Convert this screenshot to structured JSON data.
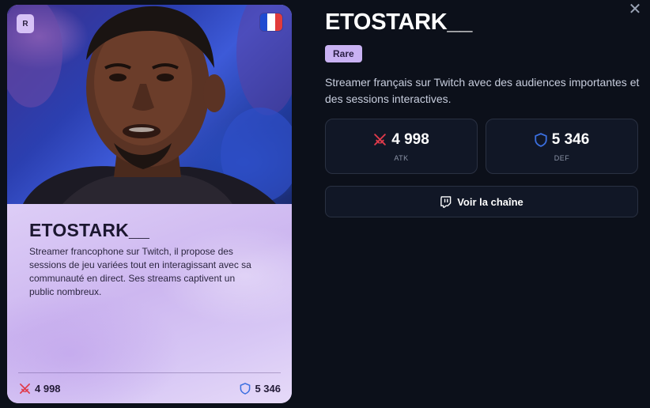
{
  "dialog": {
    "close_glyph": "✕"
  },
  "card": {
    "rarity_letter": "R",
    "flag": {
      "name": "france-flag",
      "colors": [
        "#1f4bd1",
        "#ffffff",
        "#e23b3b"
      ]
    },
    "name": "ETOSTARK__",
    "description": "Streamer francophone sur Twitch, il propose des sessions de jeu variées tout en interagissant avec sa communauté en direct. Ses streams captivent un public nombreux.",
    "atk": "4 998",
    "def": "5 346"
  },
  "details": {
    "title": "ETOSTARK__",
    "rarity": "Rare",
    "description": "Streamer français sur Twitch avec des audiences importantes et des sessions interactives.",
    "stats": [
      {
        "key": "atk",
        "value": "4 998",
        "label": "ATK",
        "icon": "crossed-swords-icon",
        "color": "#e03b4b"
      },
      {
        "key": "def",
        "value": "5 346",
        "label": "DEF",
        "icon": "shield-icon",
        "color": "#3b6fe0"
      }
    ],
    "channel_button": {
      "label": "Voir la chaîne",
      "icon": "twitch-icon"
    }
  },
  "colors": {
    "background": "#0c101a",
    "card_lavender": "#d9c9f3",
    "rarity_badge": "#c9b2f3",
    "atk": "#e03b4b",
    "def": "#3b6fe0"
  }
}
